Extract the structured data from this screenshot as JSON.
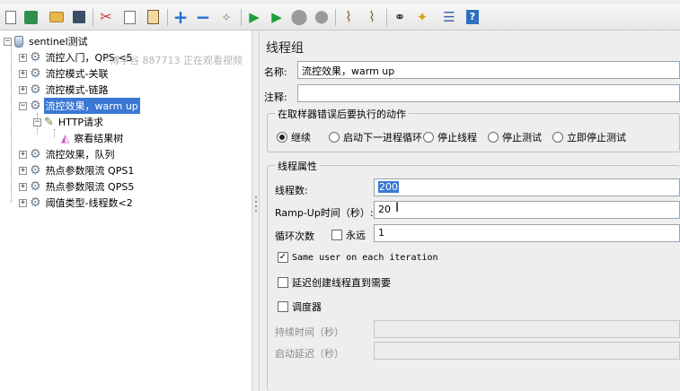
{
  "toolbar": {
    "buttons": [
      {
        "name": "new-icon",
        "glyph": "🗋"
      },
      {
        "name": "templates-icon",
        "glyph": "▦"
      },
      {
        "name": "open-icon",
        "glyph": "📂"
      },
      {
        "name": "save-icon",
        "glyph": "💾"
      },
      {
        "name": "cut-icon",
        "glyph": "✂"
      },
      {
        "name": "copy-icon",
        "glyph": "⎘"
      },
      {
        "name": "paste-icon",
        "glyph": "📋"
      },
      {
        "name": "expand-icon",
        "glyph": "+"
      },
      {
        "name": "collapse-icon",
        "glyph": "−"
      },
      {
        "name": "toggle-icon",
        "glyph": "⟡"
      },
      {
        "name": "start-icon",
        "glyph": "▶"
      },
      {
        "name": "start-no-pause-icon",
        "glyph": "▶"
      },
      {
        "name": "stop-icon",
        "glyph": "⬤"
      },
      {
        "name": "shutdown-icon",
        "glyph": "⬤"
      },
      {
        "name": "clear-icon",
        "glyph": "🧹"
      },
      {
        "name": "clear-all-icon",
        "glyph": "🧹"
      },
      {
        "name": "search-icon",
        "glyph": "🔭"
      },
      {
        "name": "reset-search-icon",
        "glyph": "🧽"
      },
      {
        "name": "function-helper-icon",
        "glyph": "☰"
      },
      {
        "name": "help-icon",
        "glyph": "?"
      }
    ]
  },
  "tree": {
    "root": "sentinel测试",
    "items": [
      "流控入门，QPS <5",
      "流控模式-关联",
      "流控模式-链路",
      "流控效果，warm up",
      "HTTP请求",
      "察看结果树",
      "流控效果，队列",
      "热点参数限流 QPS1",
      "热点参数限流 QPS5",
      "阈值类型-线程数<2"
    ]
  },
  "watermark": "-博学谷 887713 正在观看视频",
  "panel": {
    "title": "线程组",
    "name_label": "名称:",
    "name_value": "流控效果，warm up",
    "comment_label": "注释:",
    "comment_value": "",
    "error_group_label": "在取样器错误后要执行的动作",
    "error_actions": [
      "继续",
      "启动下一进程循环",
      "停止线程",
      "停止测试",
      "立即停止测试"
    ],
    "error_selected": "继续",
    "props_group_label": "线程属性",
    "threads_label": "线程数:",
    "threads_value": "200",
    "rampup_label": "Ramp-Up时间（秒）:",
    "rampup_value": "20",
    "loop_label": "循环次数",
    "forever_label": "永远",
    "loop_value": "1",
    "same_user_label": "Same user on each iteration",
    "same_user_checked": true,
    "delay_label": "延迟创建线程直到需要",
    "scheduler_label": "调度器",
    "duration_label": "持续时间（秒）",
    "startup_delay_label": "启动延迟（秒）"
  }
}
